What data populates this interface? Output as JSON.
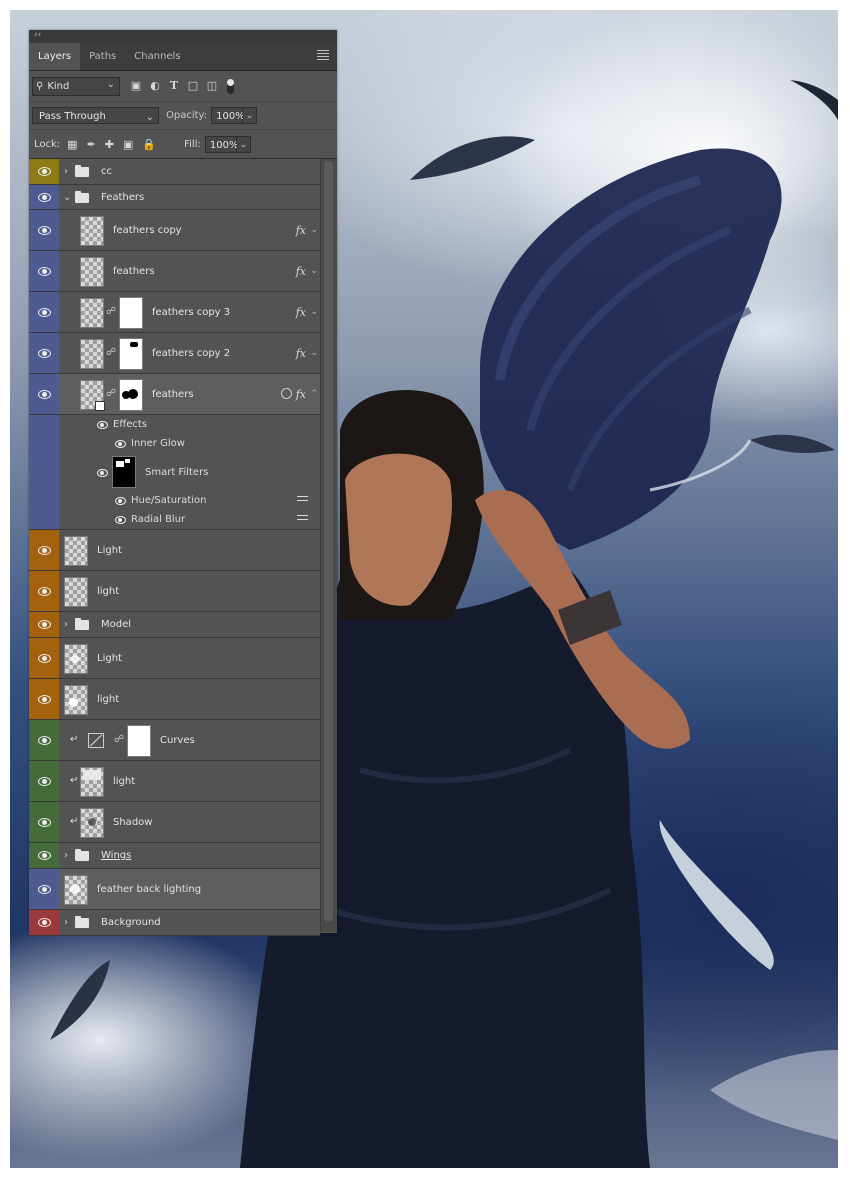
{
  "panel": {
    "collapse_glyph": "‹‹",
    "tabs": [
      {
        "label": "Layers"
      },
      {
        "label": "Paths"
      },
      {
        "label": "Channels"
      }
    ],
    "filter": {
      "kind_label": "Kind"
    },
    "blend_mode": "Pass Through",
    "opacity_label": "Opacity:",
    "opacity_value": "100%",
    "lock_label": "Lock:",
    "fill_label": "Fill:",
    "fill_value": "100%"
  },
  "layers": [
    {
      "name": "cc"
    },
    {
      "name": "Feathers"
    },
    {
      "name": "feathers copy",
      "fx": "fx"
    },
    {
      "name": "feathers",
      "fx": "fx"
    },
    {
      "name": "feathers copy 3",
      "fx": "fx"
    },
    {
      "name": "feathers copy 2",
      "fx": "fx"
    },
    {
      "name": "feathers",
      "fx": "fx"
    },
    {
      "name": "Light"
    },
    {
      "name": "light"
    },
    {
      "name": "Model"
    },
    {
      "name": "Light"
    },
    {
      "name": "light"
    },
    {
      "name": "Curves"
    },
    {
      "name": "light"
    },
    {
      "name": "Shadow"
    },
    {
      "name": "Wings"
    },
    {
      "name": "feather back lighting"
    },
    {
      "name": "Background"
    }
  ],
  "effects": {
    "effects_label": "Effects",
    "inner_glow": "Inner Glow",
    "smart_filters": "Smart Filters",
    "hue_saturation": "Hue/Saturation",
    "radial_blur": "Radial Blur"
  },
  "colors": {
    "yellow": "#8c7a17",
    "blue": "#4d5b91",
    "orange": "#a4620f",
    "green": "#466b3b",
    "red": "#9a3a3a"
  }
}
